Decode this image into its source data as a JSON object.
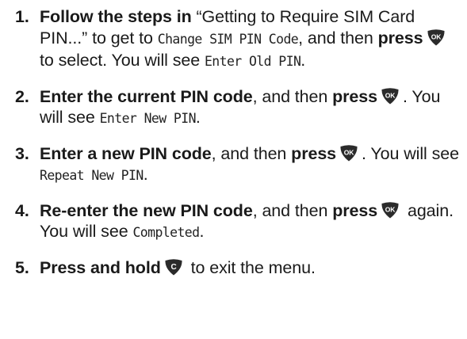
{
  "steps": [
    {
      "number": "1.",
      "bold_lead": "Follow the steps in",
      "quote": " “Getting to Require SIM Card PIN...” to get to ",
      "screen_1": "Change SIM PIN Code",
      "connector": ", and then ",
      "bold_2": "press",
      "key_label": "OK",
      "after_key": " to select. You will see ",
      "screen_2": "Enter Old PIN",
      "end": "."
    },
    {
      "number": "2.",
      "bold_lead": "Enter the current PIN code",
      "connector": ", and then ",
      "bold_2": "press",
      "key_label": "OK",
      "after_key": ". You will see ",
      "screen": "Enter New PIN",
      "end": "."
    },
    {
      "number": "3.",
      "bold_lead": "Enter a new PIN code",
      "connector": ", and then ",
      "bold_2": "press",
      "key_label": "OK",
      "after_key": ". You will see ",
      "screen": "Repeat New PIN",
      "end": "."
    },
    {
      "number": "4.",
      "bold_lead": "Re-enter the new PIN code",
      "connector": ", and then ",
      "bold_2": "press",
      "key_label": "OK",
      "after_key": " again. You will see ",
      "screen": "Completed",
      "end": "."
    },
    {
      "number": "5.",
      "bold_lead": "Press and hold",
      "key_label": "C",
      "after_key": " to exit the menu."
    }
  ],
  "colors": {
    "text": "#1a1a1a",
    "key_fill": "#2b2b2b",
    "key_label": "#ffffff"
  },
  "icons": {
    "ok_key": "ok-key-icon",
    "clear_key": "clear-key-icon"
  }
}
